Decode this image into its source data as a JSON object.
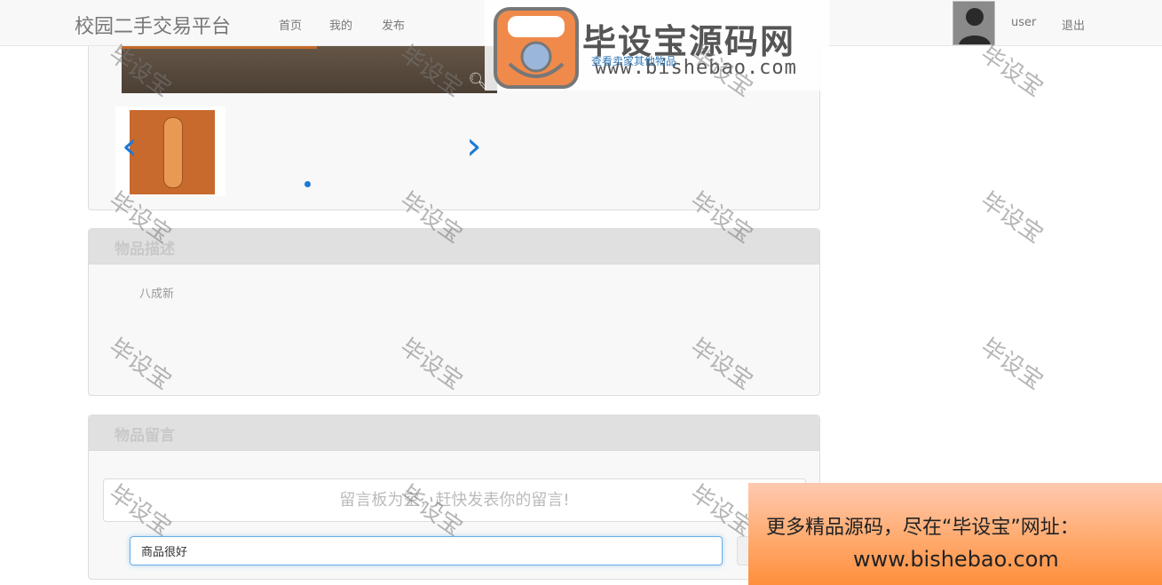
{
  "navbar": {
    "brand": "校园二手交易平台",
    "links": [
      "首页",
      "我的",
      "发布"
    ],
    "user": "user",
    "logout": "退出"
  },
  "watermark": {
    "logo_text": "毕设宝源码网",
    "logo_url": "www.bishebao.com",
    "stamp_text": "毕设宝"
  },
  "gallery": {
    "view_more": "查看卖家其他物品",
    "prev_icon": "chevron-left-icon",
    "next_icon": "chevron-right-icon"
  },
  "description": {
    "heading": "物品描述",
    "text": "八成新"
  },
  "comments": {
    "heading": "物品留言",
    "empty_text": "留言板为空，赶快发表你的留言!",
    "input_value": "商品很好"
  },
  "ad": {
    "line1": "更多精品源码，尽在“毕设宝”网址：",
    "line2": "www.bishebao.com"
  },
  "colors": {
    "link": "#337ab7",
    "carousel_accent": "#1c7ad6"
  }
}
